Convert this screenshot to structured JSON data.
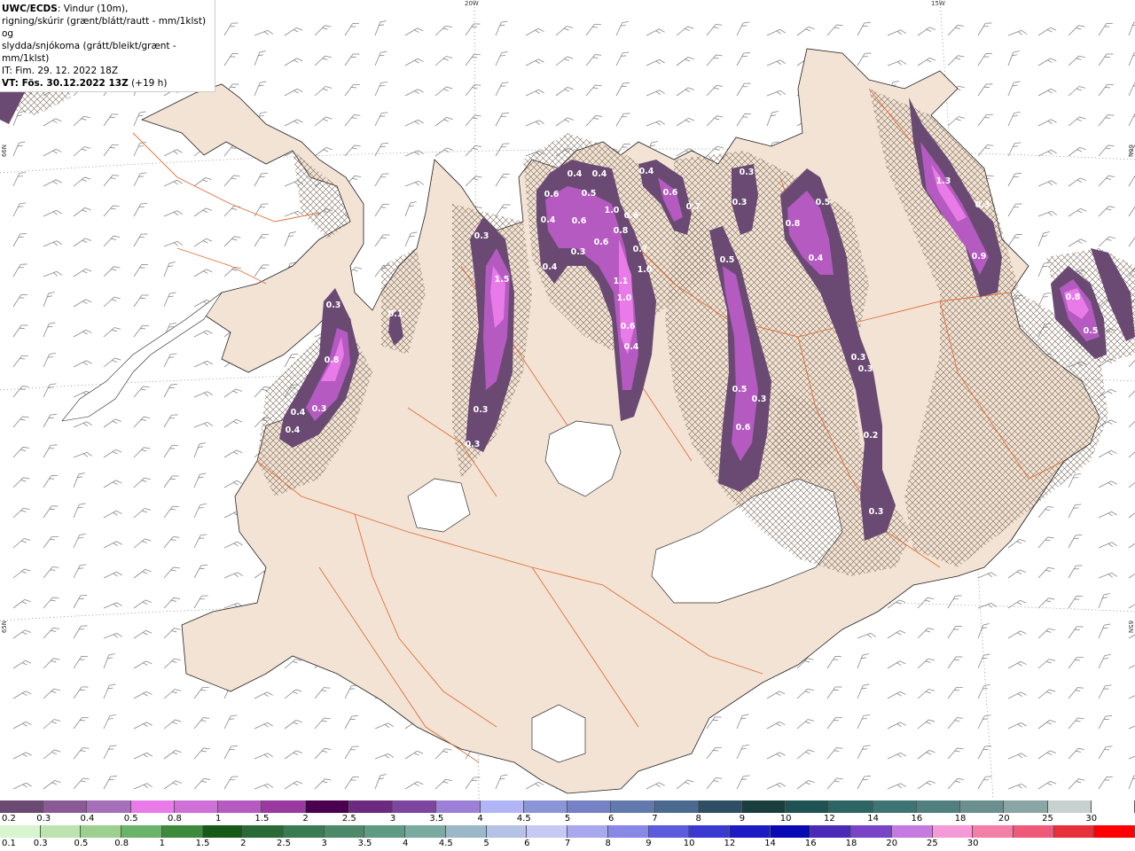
{
  "info": {
    "model": "UWC/ECDS",
    "title_rest": ": Vindur (10m),",
    "line2": "rigning/skúrir (grænt/blátt/rautt - mm/1klst) og",
    "line3": "slydda/snjókoma (grátt/bleikt/grænt - mm/1klst)",
    "it": "IT: Fim. 29. 12. 2022 18Z",
    "vt": "VT: Fös. 30.12.2022 13Z",
    "lead": "(+19 h)"
  },
  "coords": {
    "lon_20w": "20W",
    "lon_15w": "15W",
    "lat_66n_left": "66N",
    "lat_66n_right": "66N",
    "lat_65n_left": "65N",
    "lat_65n_right": "65N"
  },
  "precip_labels": [
    "0.3",
    "0.8",
    "0.4",
    "0.3",
    "0.4",
    "0.1",
    "0.3",
    "1.5",
    "0.3",
    "0.3",
    "0.6",
    "0.4",
    "0.4",
    "0.5",
    "0.6",
    "0.4",
    "0.3",
    "0.4",
    "0.6",
    "1.0",
    "0.6",
    "0.8",
    "0.7",
    "1.0",
    "1.1",
    "1.0",
    "0.6",
    "0.4",
    "0.4",
    "0.6",
    "0.7",
    "0.3",
    "0.3",
    "0.5",
    "0.5",
    "0.3",
    "0.6",
    "0.5",
    "0.8",
    "0.4",
    "0.3",
    "0.3",
    "0.2",
    "0.3",
    "1.3",
    "0.3",
    "0.9",
    "0.8",
    "0.5"
  ],
  "legend": {
    "snow_colors": [
      "#6a4a73",
      "#8a5a96",
      "#a56fb9",
      "#e87be8",
      "#cf6fd8",
      "#b45ac0",
      "#9a3aa0",
      "#4a004f",
      "#6b2a80",
      "#7d44a0",
      "#9c7fd6",
      "#b1b5f5",
      "#8c94d8",
      "#7581c4",
      "#6279ad",
      "#4a6a8f",
      "#2e4f63",
      "#1a3d3d",
      "#1f5252",
      "#2d6464",
      "#3e7474",
      "#517f7f",
      "#6b8f8f",
      "#8aa5a5",
      "#c8d0d0",
      "#ffffff"
    ],
    "snow_ticks": [
      "0.2",
      "0.3",
      "0.4",
      "0.5",
      "0.8",
      "1",
      "1.5",
      "2",
      "2.5",
      "3",
      "3.5",
      "4",
      "4.5",
      "5",
      "6",
      "7",
      "8",
      "9",
      "10",
      "12",
      "14",
      "16",
      "18",
      "20",
      "25",
      "30"
    ],
    "rain_colors": [
      "#d8f5d0",
      "#bde3b0",
      "#9ccf90",
      "#6ab36a",
      "#3d8a3d",
      "#175a17",
      "#2a6a36",
      "#3b7b52",
      "#4d8a6a",
      "#5f9a82",
      "#7aaaa0",
      "#9ab8c8",
      "#b5c2e5",
      "#c8c8f5",
      "#a8a8ee",
      "#8888e6",
      "#5b5bdd",
      "#3a3ad0",
      "#1c1cc2",
      "#0a0ab5",
      "#4a2ab8",
      "#7a44c8",
      "#c47ae0",
      "#f59ad8",
      "#f37fa8",
      "#f05a7a",
      "#e8303a",
      "#ff0000"
    ],
    "rain_ticks": [
      "0.1",
      "0.3",
      "0.5",
      "0.8",
      "1",
      "1.5",
      "2",
      "2.5",
      "3",
      "3.5",
      "4",
      "4.5",
      "5",
      "6",
      "7",
      "8",
      "9",
      "10",
      "12",
      "14",
      "16",
      "18",
      "20",
      "25",
      "30"
    ]
  }
}
